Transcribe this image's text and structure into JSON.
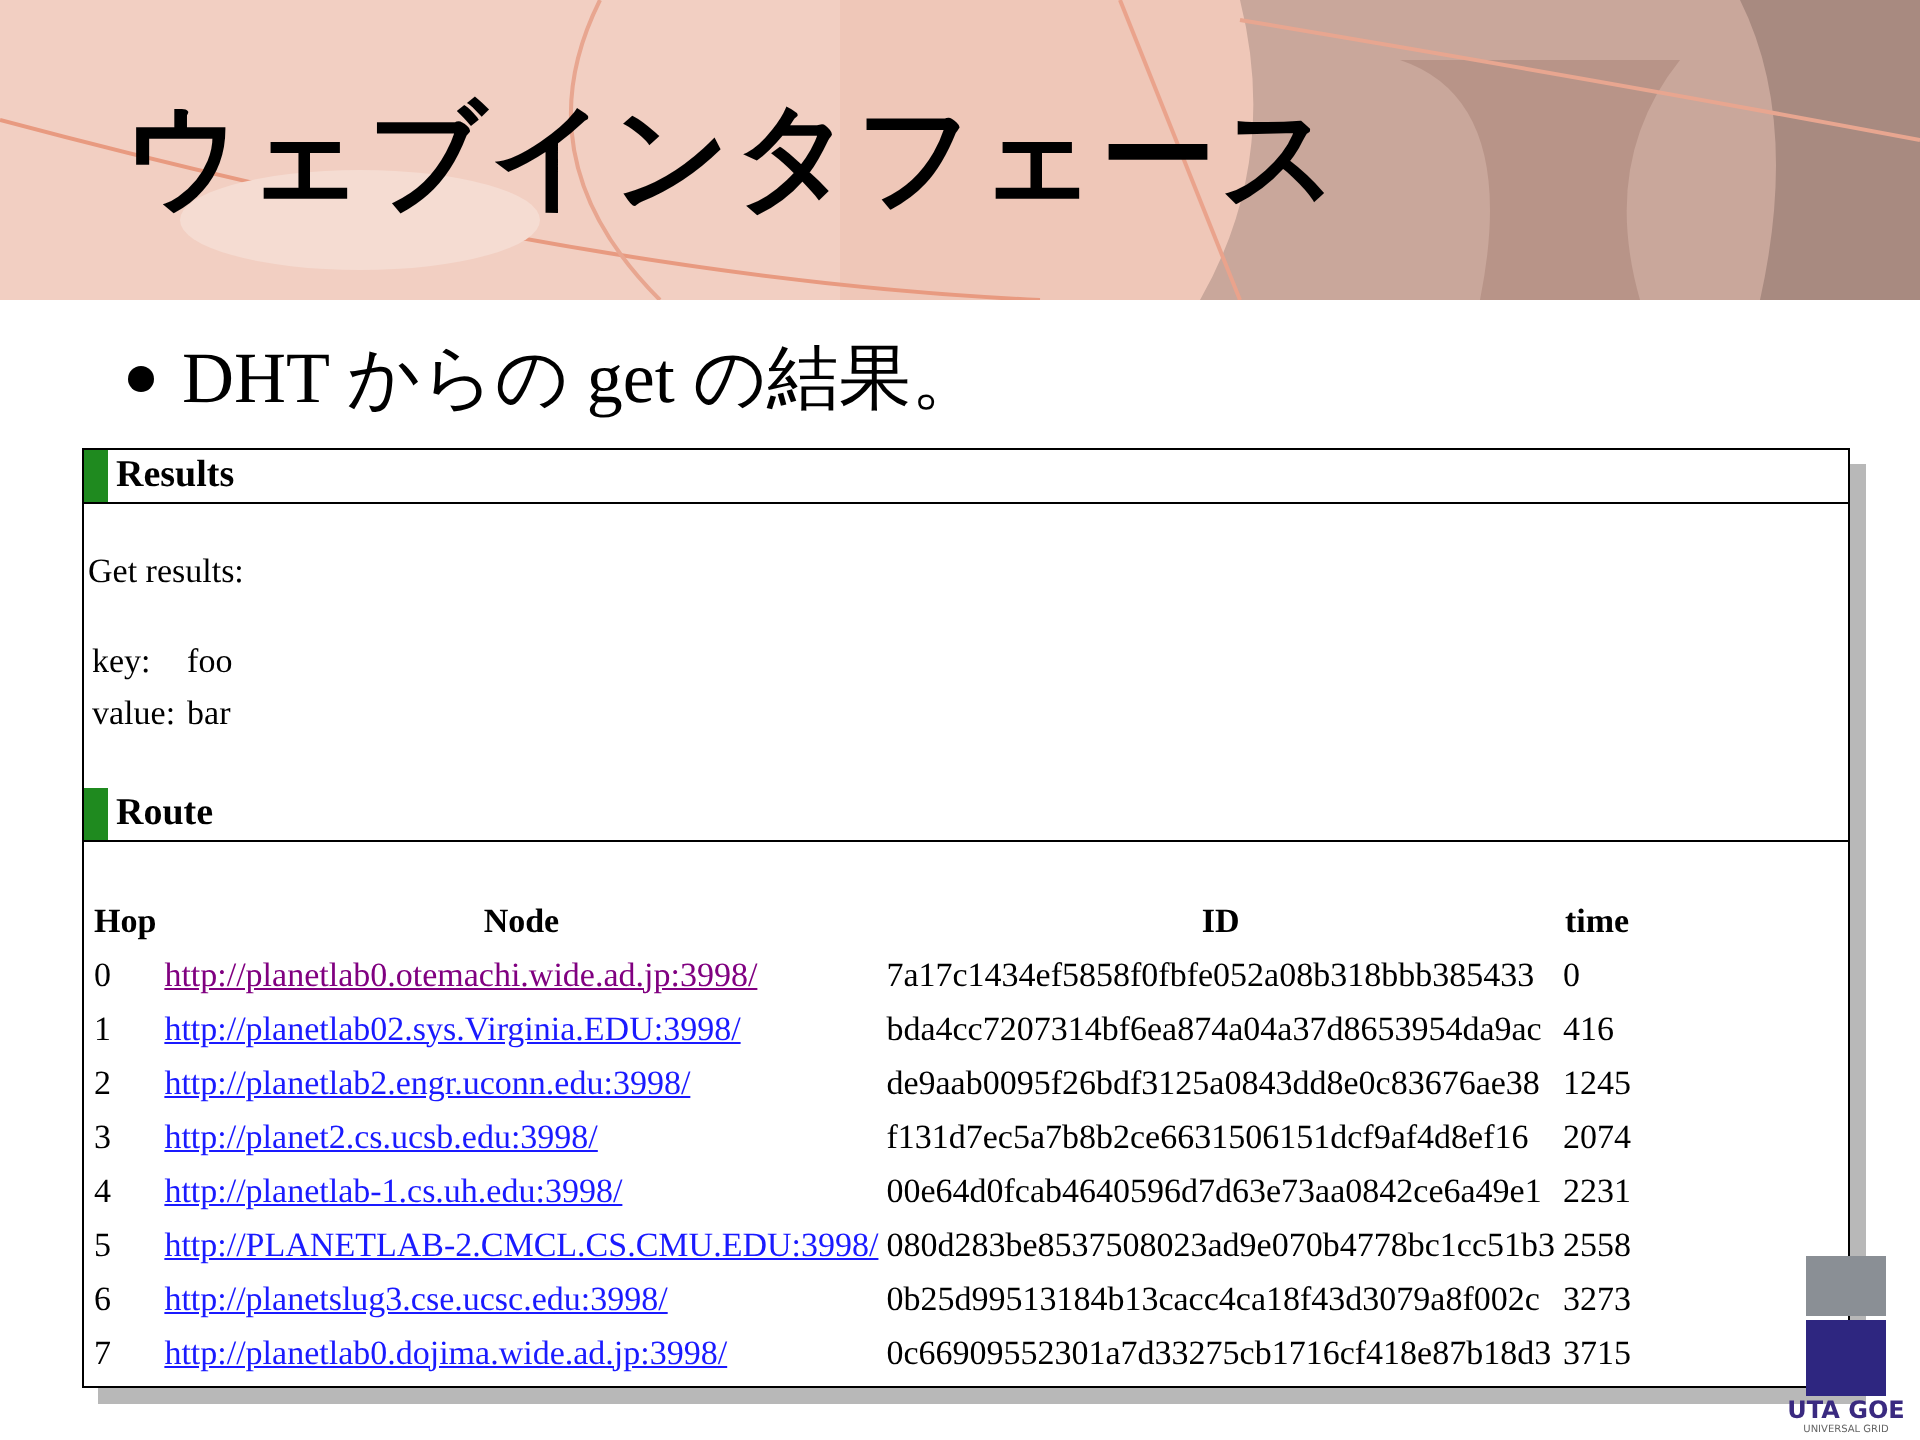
{
  "slide": {
    "title": "ウェブインタフェース",
    "bullet": "DHT からの get の結果。",
    "logo": {
      "name": "UTA GOE",
      "tagline": "UNIVERSAL GRID"
    }
  },
  "page": {
    "results": {
      "heading": "Results",
      "intro": "Get results:",
      "fields": [
        {
          "label": "key:",
          "value": "foo"
        },
        {
          "label": "value:",
          "value": "bar"
        }
      ]
    },
    "route": {
      "heading": "Route",
      "columns": [
        "Hop",
        "Node",
        "ID",
        "time"
      ],
      "rows": [
        {
          "hop": "0",
          "node": "http://planetlab0.otemachi.wide.ad.jp:3998/",
          "visited": true,
          "id": "7a17c1434ef5858f0fbfe052a08b318bbb385433",
          "time": "0"
        },
        {
          "hop": "1",
          "node": "http://planetlab02.sys.Virginia.EDU:3998/",
          "visited": false,
          "id": "bda4cc7207314bf6ea874a04a37d8653954da9ac",
          "time": "416"
        },
        {
          "hop": "2",
          "node": "http://planetlab2.engr.uconn.edu:3998/",
          "visited": false,
          "id": "de9aab0095f26bdf3125a0843dd8e0c83676ae38",
          "time": "1245"
        },
        {
          "hop": "3",
          "node": "http://planet2.cs.ucsb.edu:3998/",
          "visited": false,
          "id": "f131d7ec5a7b8b2ce6631506151dcf9af4d8ef16",
          "time": "2074"
        },
        {
          "hop": "4",
          "node": "http://planetlab-1.cs.uh.edu:3998/",
          "visited": false,
          "id": "00e64d0fcab4640596d7d63e73aa0842ce6a49e1",
          "time": "2231"
        },
        {
          "hop": "5",
          "node": "http://PLANETLAB-2.CMCL.CS.CMU.EDU:3998/",
          "visited": false,
          "id": "080d283be8537508023ad9e070b4778bc1cc51b3",
          "time": "2558"
        },
        {
          "hop": "6",
          "node": "http://planetslug3.cse.ucsc.edu:3998/",
          "visited": false,
          "id": "0b25d99513184b13cacc4ca18f43d3079a8f002c",
          "time": "3273"
        },
        {
          "hop": "7",
          "node": "http://planetlab0.dojima.wide.ad.jp:3998/",
          "visited": false,
          "id": "0c66909552301a7d33275cb1716cf418e87b18d3",
          "time": "3715"
        }
      ]
    }
  }
}
